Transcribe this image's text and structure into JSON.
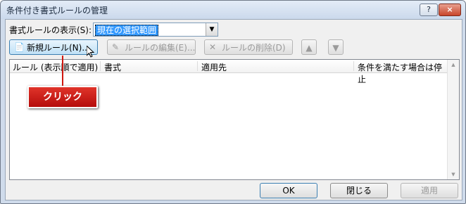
{
  "window": {
    "title": "条件付き書式ルールの管理",
    "help": "?",
    "close": "×"
  },
  "show_rules": {
    "label": "書式ルールの表示(S):",
    "value": "現在の選択範囲"
  },
  "toolbar": {
    "new_rule": "新規ルール(N)...",
    "edit_rule": "ルールの編集(E)...",
    "delete_rule": "ルールの削除(D)"
  },
  "columns": [
    "ルール (表示順で適用)",
    "書式",
    "適用先",
    "条件を満たす場合は停止"
  ],
  "callout": "クリック",
  "buttons": {
    "ok": "OK",
    "close": "閉じる",
    "apply": "適用"
  },
  "colors": {
    "callout": "#d0170f",
    "selection": "#3399ff"
  }
}
